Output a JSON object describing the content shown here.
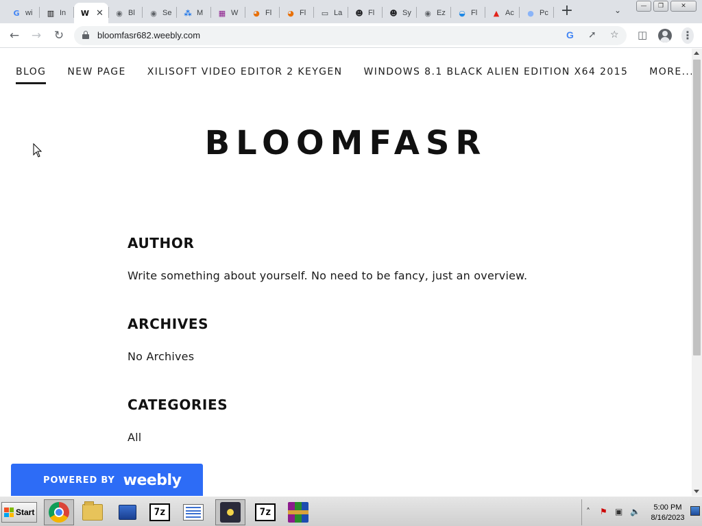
{
  "browser": {
    "tabs": [
      {
        "icon": "google-icon",
        "title": "wi",
        "active": false
      },
      {
        "icon": "institution-icon",
        "title": "In",
        "active": false
      },
      {
        "icon": "weebly-w-icon",
        "title": "",
        "active": true
      },
      {
        "icon": "globe-icon",
        "title": "Bl",
        "active": false
      },
      {
        "icon": "globe-icon",
        "title": "Se",
        "active": false
      },
      {
        "icon": "molecule-icon",
        "title": "M",
        "active": false
      },
      {
        "icon": "winrar-icon",
        "title": "W",
        "active": false
      },
      {
        "icon": "pizza-icon",
        "title": "Fl",
        "active": false
      },
      {
        "icon": "pizza-icon",
        "title": "Fl",
        "active": false
      },
      {
        "icon": "laptop-icon",
        "title": "La",
        "active": false
      },
      {
        "icon": "alien-icon",
        "title": "Fl",
        "active": false
      },
      {
        "icon": "alien-icon",
        "title": "Sy",
        "active": false
      },
      {
        "icon": "globe-icon",
        "title": "Ez",
        "active": false
      },
      {
        "icon": "swirl-icon",
        "title": "Fl",
        "active": false
      },
      {
        "icon": "adobe-icon",
        "title": "Ac",
        "active": false
      },
      {
        "icon": "planet-icon",
        "title": "Pc",
        "active": false
      }
    ],
    "new_tab_glyph": "+",
    "close_tab_glyph": "✕",
    "url": "bloomfasr682.weebly.com"
  },
  "site": {
    "nav": [
      "BLOG",
      "NEW PAGE",
      "XILISOFT VIDEO EDITOR 2 KEYGEN",
      "WINDOWS 8.1 BLACK ALIEN EDITION X64 2015",
      "MORE..."
    ],
    "title": "BLOOMFASR",
    "sections": [
      {
        "heading": "AUTHOR",
        "text": "Write something about yourself. No need to be fancy, just an overview."
      },
      {
        "heading": "ARCHIVES",
        "text": "No Archives"
      },
      {
        "heading": "CATEGORIES",
        "text": "All"
      }
    ],
    "badge": {
      "prefix": "POWERED BY",
      "brand": "weebly"
    },
    "accent_color": "#2d6cf6"
  },
  "taskbar": {
    "start_label": "Start",
    "apps": [
      "chrome-icon",
      "file-explorer-icon",
      "network-computer-icon",
      "7zip-icon",
      "list-app-icon",
      "cat-app-icon",
      "7zip-icon",
      "winrar-icon"
    ],
    "sevenzip_label": "7z",
    "time": "5:00 PM",
    "date": "8/16/2023"
  }
}
